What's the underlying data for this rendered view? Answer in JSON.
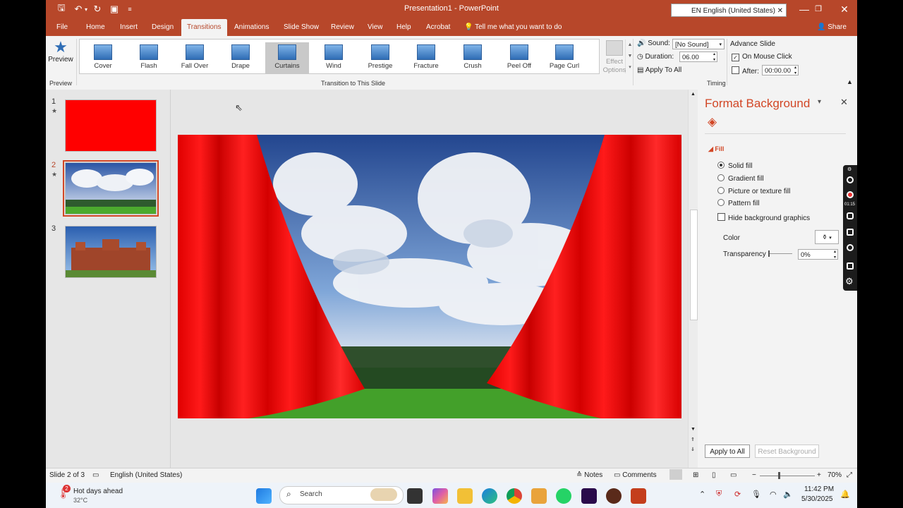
{
  "title": "Presentation1 - PowerPoint",
  "language_box": "EN English (United States)",
  "menu": {
    "tabs": [
      "File",
      "Home",
      "Insert",
      "Design",
      "Transitions",
      "Animations",
      "Slide Show",
      "Review",
      "View",
      "Help",
      "Acrobat"
    ],
    "active": "Transitions",
    "tell_me": "Tell me what you want to do",
    "share": "Share"
  },
  "ribbon": {
    "preview_label": "Preview",
    "preview_group": "Preview",
    "transitions": [
      "Cover",
      "Flash",
      "Fall Over",
      "Drape",
      "Curtains",
      "Wind",
      "Prestige",
      "Fracture",
      "Crush",
      "Peel Off",
      "Page Curl"
    ],
    "selected_transition": "Curtains",
    "effect_options_1": "Effect",
    "effect_options_2": "Options",
    "transition_group": "Transition to This Slide",
    "sound_label": "Sound:",
    "sound_value": "[No Sound]",
    "duration_label": "Duration:",
    "duration_value": "06.00",
    "apply_all": "Apply To All",
    "advance_title": "Advance Slide",
    "on_mouse_click": "On Mouse Click",
    "after_label": "After:",
    "after_value": "00:00.00",
    "timing_group": "Timing"
  },
  "thumbnails": [
    {
      "num": "1",
      "star": "★"
    },
    {
      "num": "2",
      "star": "★"
    },
    {
      "num": "3",
      "star": ""
    }
  ],
  "format_pane": {
    "title": "Format Background",
    "section": "Fill",
    "options": [
      "Solid fill",
      "Gradient fill",
      "Picture or texture fill",
      "Pattern fill"
    ],
    "selected": "Solid fill",
    "hide_graphics": "Hide background graphics",
    "color_label": "Color",
    "transparency_label": "Transparency",
    "transparency_value": "0%",
    "apply_all": "Apply to All",
    "reset": "Reset Background"
  },
  "status": {
    "slide": "Slide 2 of 3",
    "language": "English (United States)",
    "notes": "Notes",
    "comments": "Comments",
    "zoom": "70%"
  },
  "taskbar": {
    "weather_title": "Hot days ahead",
    "weather_temp": "32°C",
    "weather_badge": "2",
    "search": "Search",
    "time": "11:42 PM",
    "date": "5/30/2025"
  },
  "recorder": {
    "time": "01:15"
  },
  "colors": {
    "accent": "#b7472a",
    "pane_title": "#d24726",
    "curtain": "#ff0000"
  }
}
